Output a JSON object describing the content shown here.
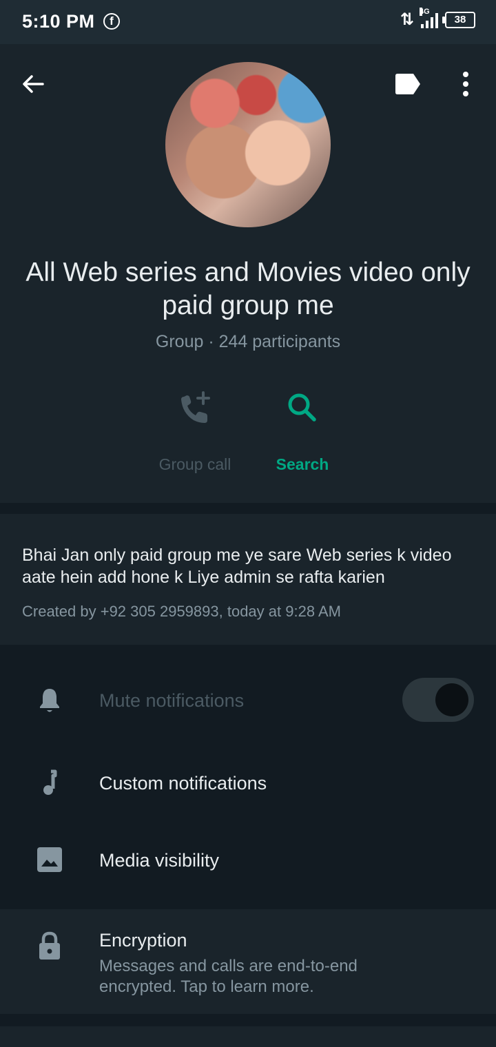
{
  "status_bar": {
    "time": "5:10 PM",
    "facebook_icon": "f",
    "data_arrows": "⇅",
    "network": "4G",
    "battery": "38"
  },
  "header": {
    "back_icon": "arrow-left-icon",
    "label_icon": "label-icon",
    "more_icon": "more-vertical-icon",
    "group_name": "All Web series and Movies video only paid group me",
    "subtitle": "Group · 244 participants"
  },
  "actions": {
    "group_call_label": "Group call",
    "search_label": "Search",
    "accent_color": "#00a884"
  },
  "description": {
    "text": "Bhai Jan only paid group me ye sare Web series k video aate hein add hone k Liye admin se rafta karien",
    "created": "Created by +92 305 2959893, today at 9:28 AM"
  },
  "settings": {
    "mute_label": "Mute notifications",
    "mute_enabled": false,
    "custom_label": "Custom notifications",
    "media_label": "Media visibility"
  },
  "encryption": {
    "title": "Encryption",
    "description": "Messages and calls are end-to-end encrypted. Tap to learn more."
  }
}
